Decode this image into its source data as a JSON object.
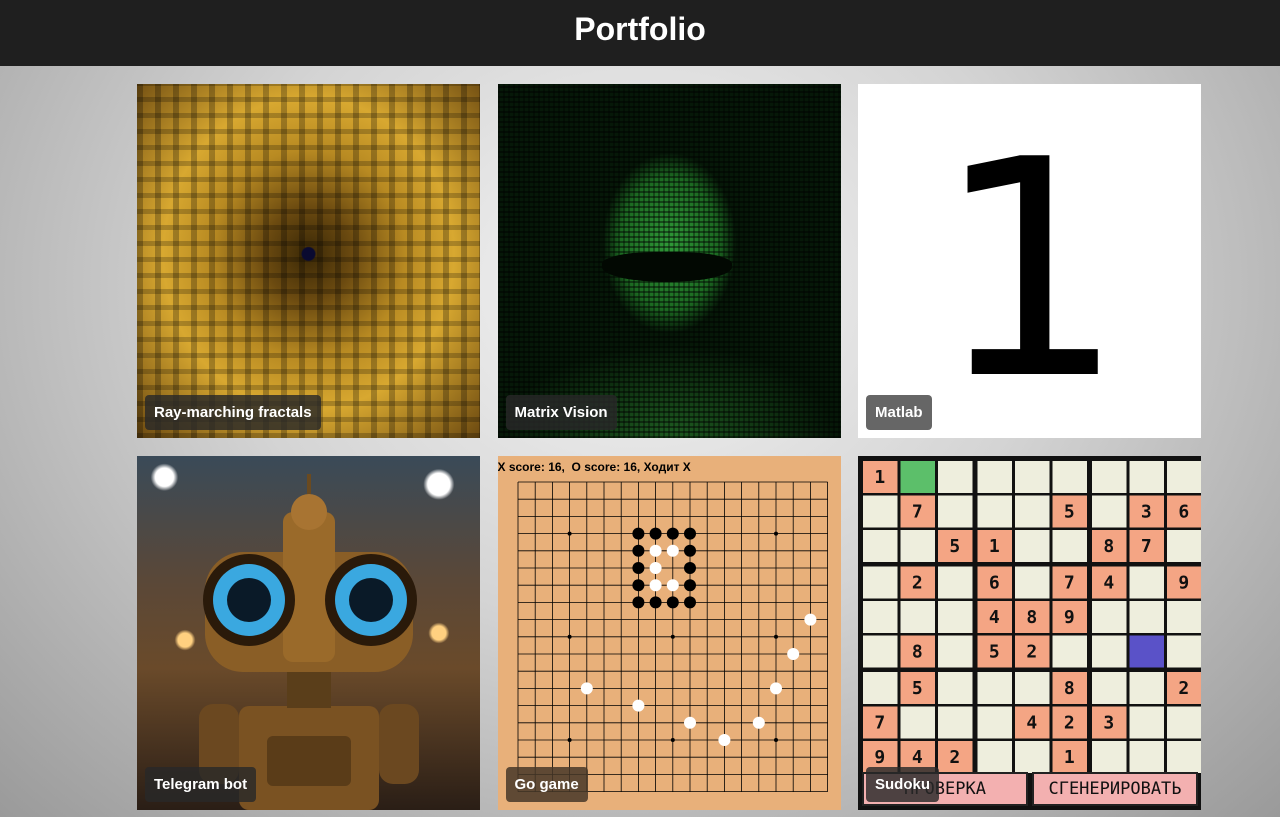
{
  "header": {
    "title": "Portfolio"
  },
  "cards": [
    {
      "caption": "Ray-marching fractals"
    },
    {
      "caption": "Matrix Vision"
    },
    {
      "caption": "Matlab",
      "digit": "1"
    },
    {
      "caption": "Telegram bot"
    },
    {
      "caption": "Go game",
      "score_text": "X score: 16,  O score: 16, Ходит X"
    },
    {
      "caption": "Sudoku",
      "check_label": "ПРОВЕРКА",
      "generate_label": "СГЕНЕРИРОВАТЬ"
    }
  ],
  "go_board": {
    "size": 19,
    "black": [
      [
        7,
        3
      ],
      [
        8,
        3
      ],
      [
        9,
        3
      ],
      [
        10,
        3
      ],
      [
        7,
        4
      ],
      [
        10,
        4
      ],
      [
        7,
        5
      ],
      [
        10,
        5
      ],
      [
        7,
        6
      ],
      [
        10,
        6
      ],
      [
        7,
        7
      ],
      [
        8,
        7
      ],
      [
        9,
        7
      ],
      [
        10,
        7
      ]
    ],
    "white": [
      [
        8,
        4
      ],
      [
        9,
        4
      ],
      [
        8,
        5
      ],
      [
        8,
        6
      ],
      [
        9,
        6
      ],
      [
        17,
        8
      ],
      [
        16,
        10
      ],
      [
        4,
        12
      ],
      [
        15,
        12
      ],
      [
        7,
        13
      ],
      [
        10,
        14
      ],
      [
        14,
        14
      ],
      [
        12,
        15
      ]
    ]
  },
  "sudoku": {
    "grid": [
      [
        "1",
        "",
        "",
        "",
        "",
        "",
        "",
        "",
        ""
      ],
      [
        "",
        "7",
        "",
        "",
        "",
        "5",
        "",
        "3",
        "6"
      ],
      [
        "",
        "",
        "5",
        "1",
        "",
        "",
        "8",
        "7",
        ""
      ],
      [
        "",
        "2",
        "",
        "6",
        "",
        "7",
        "4",
        "",
        "9"
      ],
      [
        "",
        "",
        "",
        "4",
        "8",
        "9",
        "",
        "",
        ""
      ],
      [
        "",
        "8",
        "",
        "5",
        "2",
        "",
        "",
        "",
        ""
      ],
      [
        "",
        "5",
        "",
        "",
        "",
        "8",
        "",
        "",
        "2"
      ],
      [
        "7",
        "",
        "",
        "",
        "4",
        "2",
        "3",
        "",
        ""
      ],
      [
        "9",
        "4",
        "2",
        "",
        "",
        "1",
        "",
        "",
        ""
      ]
    ],
    "highlight": {
      "green": [
        0,
        1
      ],
      "blue": [
        5,
        7
      ]
    },
    "colors": {
      "given": "#f4a584",
      "empty": "#eeeedd",
      "green": "#5cbf6a",
      "blue": "#5a52c8"
    }
  }
}
